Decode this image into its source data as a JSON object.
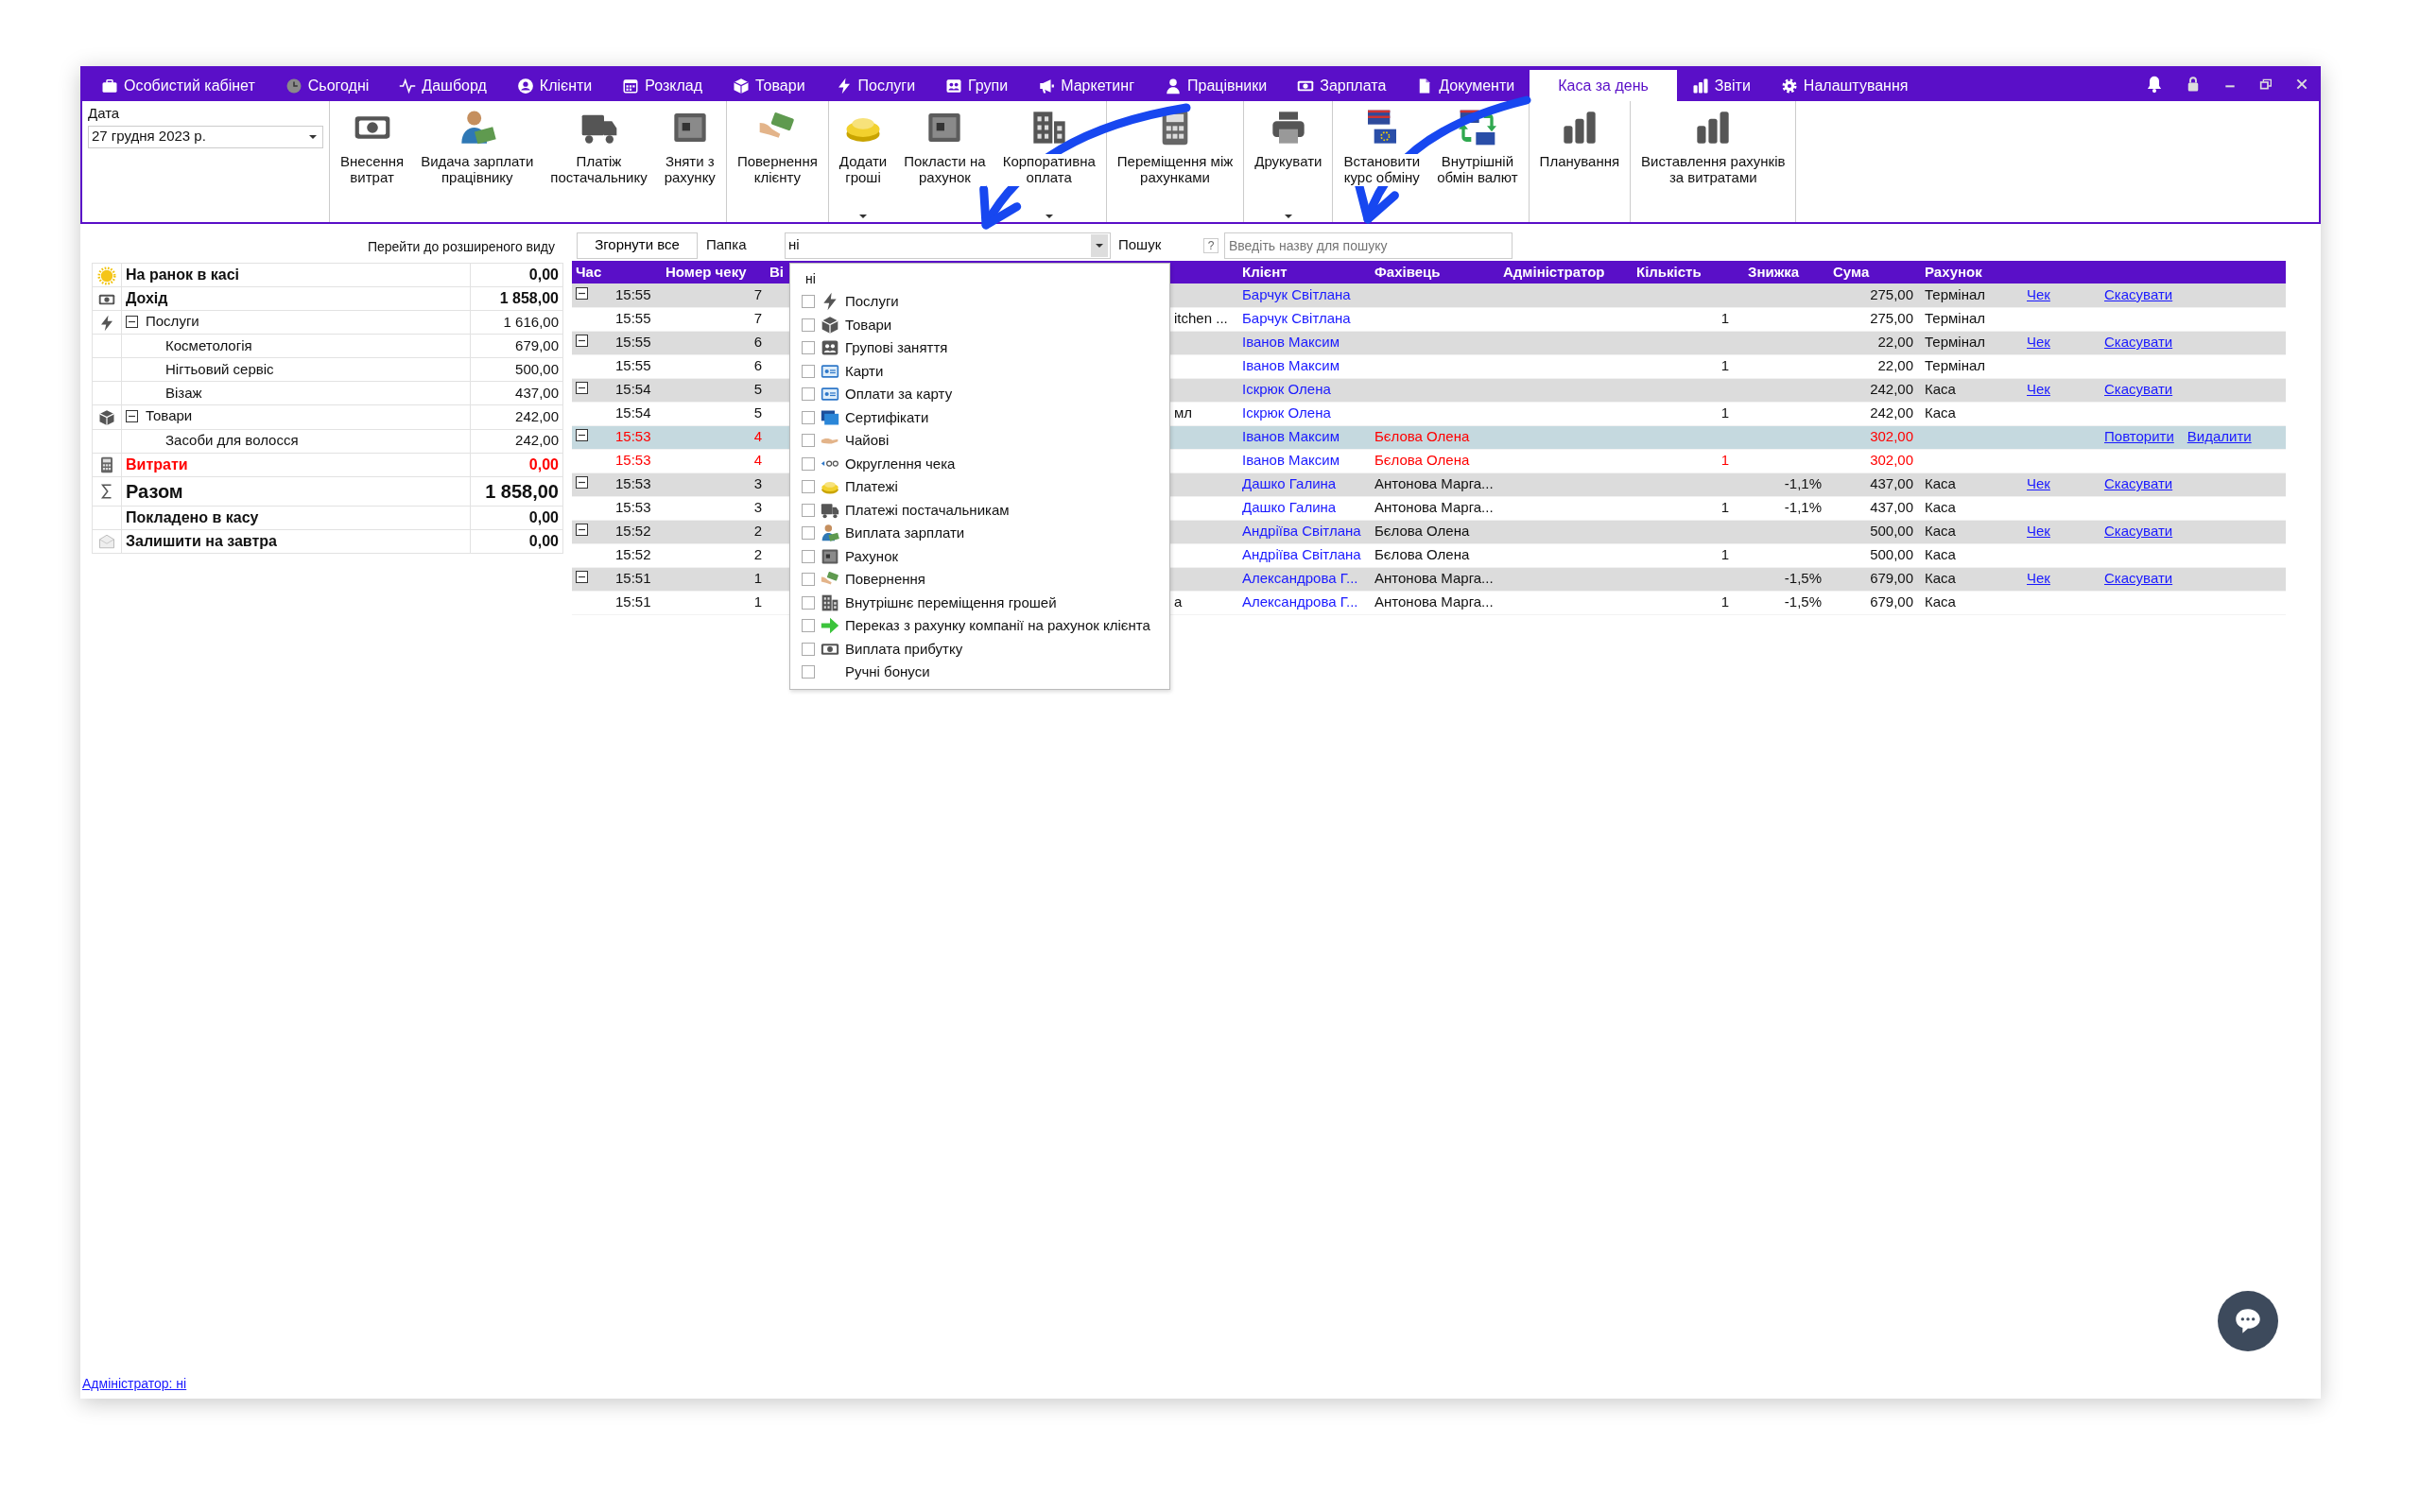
{
  "nav_tabs": [
    {
      "label": "Особистий кабінет",
      "selected": false
    },
    {
      "label": "Сьогодні",
      "selected": false
    },
    {
      "label": "Дашборд",
      "selected": false
    },
    {
      "label": "Клієнти",
      "selected": false
    },
    {
      "label": "Розклад",
      "selected": false
    },
    {
      "label": "Товари",
      "selected": false
    },
    {
      "label": "Послуги",
      "selected": false
    },
    {
      "label": "Групи",
      "selected": false
    },
    {
      "label": "Маркетинг",
      "selected": false
    },
    {
      "label": "Працівники",
      "selected": false
    },
    {
      "label": "Зарплата",
      "selected": false
    },
    {
      "label": "Документи",
      "selected": false
    },
    {
      "label": "Каса за день",
      "selected": true
    },
    {
      "label": "Звіти",
      "selected": false
    },
    {
      "label": "Налаштування",
      "selected": false
    }
  ],
  "date": {
    "label": "Дата",
    "value": "27 грудня  2023 р."
  },
  "toolbar": [
    [
      {
        "label": "Внесення\nвитрат",
        "menu": false
      },
      {
        "label": "Видача зарплати\nпрацівнику",
        "menu": false
      },
      {
        "label": "Платіж\nпостачальнику",
        "menu": false
      },
      {
        "label": "Зняти з\nрахунку",
        "menu": false
      }
    ],
    [
      {
        "label": "Повернення\nклієнту",
        "menu": false
      }
    ],
    [
      {
        "label": "Додати\nгроші",
        "menu": true
      },
      {
        "label": "Покласти на\nрахунок",
        "menu": false
      },
      {
        "label": "Корпоративна\nоплата",
        "menu": true
      }
    ],
    [
      {
        "label": "Переміщення між\nрахунками",
        "menu": false
      }
    ],
    [
      {
        "label": "Друкувати",
        "menu": true
      }
    ],
    [
      {
        "label": "Встановити\nкурс обміну",
        "menu": false
      },
      {
        "label": "Внутрішній\nобмін валют",
        "menu": false
      }
    ],
    [
      {
        "label": "Планування",
        "menu": false
      }
    ],
    [
      {
        "label": "Виставлення рахунків\nза витратами",
        "menu": false
      }
    ]
  ],
  "summary": {
    "link": "Перейти до розширеного виду",
    "rows": [
      {
        "label": "На ранок в касі",
        "value": "0,00",
        "kind": "heading"
      },
      {
        "label": "Дохід",
        "value": "1 858,00",
        "kind": "heading"
      },
      {
        "label": "Послуги",
        "value": "1 616,00",
        "kind": "group",
        "expanded": true,
        "children": [
          {
            "label": "Косметологія",
            "value": "679,00"
          },
          {
            "label": "Нігтьовий сервіс",
            "value": "500,00"
          },
          {
            "label": "Візаж",
            "value": "437,00"
          }
        ]
      },
      {
        "label": "Товари",
        "value": "242,00",
        "kind": "group",
        "expanded": true,
        "children": [
          {
            "label": "Засоби для волосся",
            "value": "242,00"
          }
        ]
      },
      {
        "label": "Витрати",
        "value": "0,00",
        "kind": "expense"
      },
      {
        "label": "Разом",
        "value": "1 858,00",
        "kind": "total"
      },
      {
        "label": "Покладено в касу",
        "value": "0,00",
        "kind": "heading"
      },
      {
        "label": "Залишити на завтра",
        "value": "0,00",
        "kind": "heading"
      }
    ]
  },
  "filter": {
    "collapse_button": "Згорнути все",
    "folder_label": "Папка",
    "folder_value": "ні",
    "search_label": "Пошук",
    "help": "?",
    "search_placeholder": "Введіть назву для пошуку"
  },
  "folder_menu": {
    "header": "ні",
    "items": [
      {
        "label": "Послуги",
        "checked": false
      },
      {
        "label": "Товари",
        "checked": false
      },
      {
        "label": "Групові заняття",
        "checked": false
      },
      {
        "label": "Карти",
        "checked": false
      },
      {
        "label": "Оплати за карту",
        "checked": false
      },
      {
        "label": "Сертифікати",
        "checked": false
      },
      {
        "label": "Чайові",
        "checked": false
      },
      {
        "label": "Округлення чека",
        "checked": false
      },
      {
        "label": "Платежі",
        "checked": false
      },
      {
        "label": "Платежі постачальникам",
        "checked": false
      },
      {
        "label": "Виплата зарплати",
        "checked": false
      },
      {
        "label": "Рахунок",
        "checked": false
      },
      {
        "label": "Повернення",
        "checked": false
      },
      {
        "label": "Внутрішнє переміщення грошей",
        "checked": false
      },
      {
        "label": "Переказ з рахунку компанії на рахунок клієнта",
        "checked": false
      },
      {
        "label": "Виплата прибутку",
        "checked": false
      },
      {
        "label": "Ручні бонуси",
        "checked": false
      }
    ]
  },
  "table": {
    "columns": [
      "Час",
      "Номер чеку",
      "Ві",
      "Клієнт",
      "Фахівець",
      "Адміністратор",
      "Кількість",
      "Знижка",
      "Сума",
      "Рахунок"
    ],
    "rows": [
      {
        "kind": "receipt",
        "expanded": true,
        "selected": false,
        "cancelled": false,
        "time": "15:55",
        "number": "7",
        "client": "Барчук Світлана",
        "sum": "275,00",
        "account": "Термінал",
        "receipt_link": "Чек",
        "actions": [
          "Скасувати"
        ]
      },
      {
        "kind": "item",
        "selected": false,
        "cancelled": false,
        "time": "15:55",
        "number": "7",
        "column_4": "itchen ...",
        "client": "Барчук Світлана",
        "quantity": "1",
        "sum": "275,00",
        "account": "Термінал"
      },
      {
        "kind": "receipt",
        "expanded": true,
        "selected": false,
        "cancelled": false,
        "time": "15:55",
        "number": "6",
        "client": "Іванов Максим",
        "sum": "22,00",
        "account": "Термінал",
        "receipt_link": "Чек",
        "actions": [
          "Скасувати"
        ]
      },
      {
        "kind": "item",
        "selected": false,
        "cancelled": false,
        "time": "15:55",
        "number": "6",
        "client": "Іванов Максим",
        "quantity": "1",
        "sum": "22,00",
        "account": "Термінал"
      },
      {
        "kind": "receipt",
        "expanded": true,
        "selected": false,
        "cancelled": false,
        "time": "15:54",
        "number": "5",
        "client": "Іскрюк Олена",
        "sum": "242,00",
        "account": "Каса",
        "receipt_link": "Чек",
        "actions": [
          "Скасувати"
        ]
      },
      {
        "kind": "item",
        "selected": false,
        "cancelled": false,
        "time": "15:54",
        "number": "5",
        "column_4": "мл",
        "client": "Іскрюк Олена",
        "quantity": "1",
        "sum": "242,00",
        "account": "Каса"
      },
      {
        "kind": "receipt",
        "expanded": true,
        "selected": true,
        "cancelled": true,
        "time": "15:53",
        "number": "4",
        "client": "Іванов Максим",
        "specialist": "Бєлова Олена",
        "sum": "302,00",
        "actions": [
          "Повторити",
          "Видалити"
        ]
      },
      {
        "kind": "item",
        "selected": false,
        "cancelled": true,
        "time": "15:53",
        "number": "4",
        "client": "Іванов Максим",
        "specialist": "Бєлова Олена",
        "quantity": "1",
        "sum": "302,00"
      },
      {
        "kind": "receipt",
        "expanded": true,
        "selected": false,
        "cancelled": false,
        "time": "15:53",
        "number": "3",
        "client": "Дашко Галина",
        "specialist": "Антонова Марга...",
        "discount": "-1,1%",
        "sum": "437,00",
        "account": "Каса",
        "receipt_link": "Чек",
        "actions": [
          "Скасувати"
        ]
      },
      {
        "kind": "item",
        "selected": false,
        "cancelled": false,
        "time": "15:53",
        "number": "3",
        "client": "Дашко Галина",
        "specialist": "Антонова Марга...",
        "quantity": "1",
        "discount": "-1,1%",
        "sum": "437,00",
        "account": "Каса"
      },
      {
        "kind": "receipt",
        "expanded": true,
        "selected": false,
        "cancelled": false,
        "time": "15:52",
        "number": "2",
        "client": "Андріїва Світлана",
        "specialist": "Бєлова Олена",
        "sum": "500,00",
        "account": "Каса",
        "receipt_link": "Чек",
        "actions": [
          "Скасувати"
        ]
      },
      {
        "kind": "item",
        "selected": false,
        "cancelled": false,
        "time": "15:52",
        "number": "2",
        "client": "Андріїва Світлана",
        "specialist": "Бєлова Олена",
        "quantity": "1",
        "sum": "500,00",
        "account": "Каса"
      },
      {
        "kind": "receipt",
        "expanded": true,
        "selected": false,
        "cancelled": false,
        "time": "15:51",
        "number": "1",
        "client": "Александрова Г...",
        "specialist": "Антонова Марга...",
        "discount": "-1,5%",
        "sum": "679,00",
        "account": "Каса",
        "receipt_link": "Чек",
        "actions": [
          "Скасувати"
        ]
      },
      {
        "kind": "item",
        "selected": false,
        "cancelled": false,
        "time": "15:51",
        "number": "1",
        "column_4": "а",
        "client": "Александрова Г...",
        "specialist": "Антонова Марга...",
        "quantity": "1",
        "discount": "-1,5%",
        "sum": "679,00",
        "account": "Каса"
      }
    ]
  },
  "footer": {
    "admin_link": "Адміністратор: ні"
  }
}
